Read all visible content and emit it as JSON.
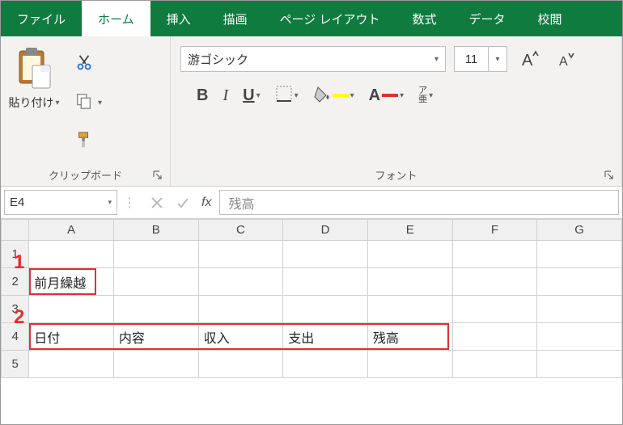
{
  "tabs": {
    "file": "ファイル",
    "home": "ホーム",
    "insert": "挿入",
    "draw": "描画",
    "pagelayout": "ページ レイアウト",
    "formulas": "数式",
    "data": "データ",
    "review": "校閲"
  },
  "ribbon": {
    "clipboard": {
      "paste_label": "貼り付け",
      "group_label": "クリップボード"
    },
    "font": {
      "name": "游ゴシック",
      "size": "11",
      "group_label": "フォント",
      "ruby_label": "ア\n亜"
    }
  },
  "formula_bar": {
    "cell_ref": "E4",
    "value": "残高",
    "fx": "fx"
  },
  "grid": {
    "columns": [
      "A",
      "B",
      "C",
      "D",
      "E",
      "F",
      "G"
    ],
    "rows": [
      "1",
      "2",
      "3",
      "4",
      "5"
    ],
    "cells": {
      "A2": "前月繰越",
      "A4": "日付",
      "B4": "内容",
      "C4": "収入",
      "D4": "支出",
      "E4": "残高"
    }
  },
  "annotations": {
    "n1": "1",
    "n2": "2"
  }
}
